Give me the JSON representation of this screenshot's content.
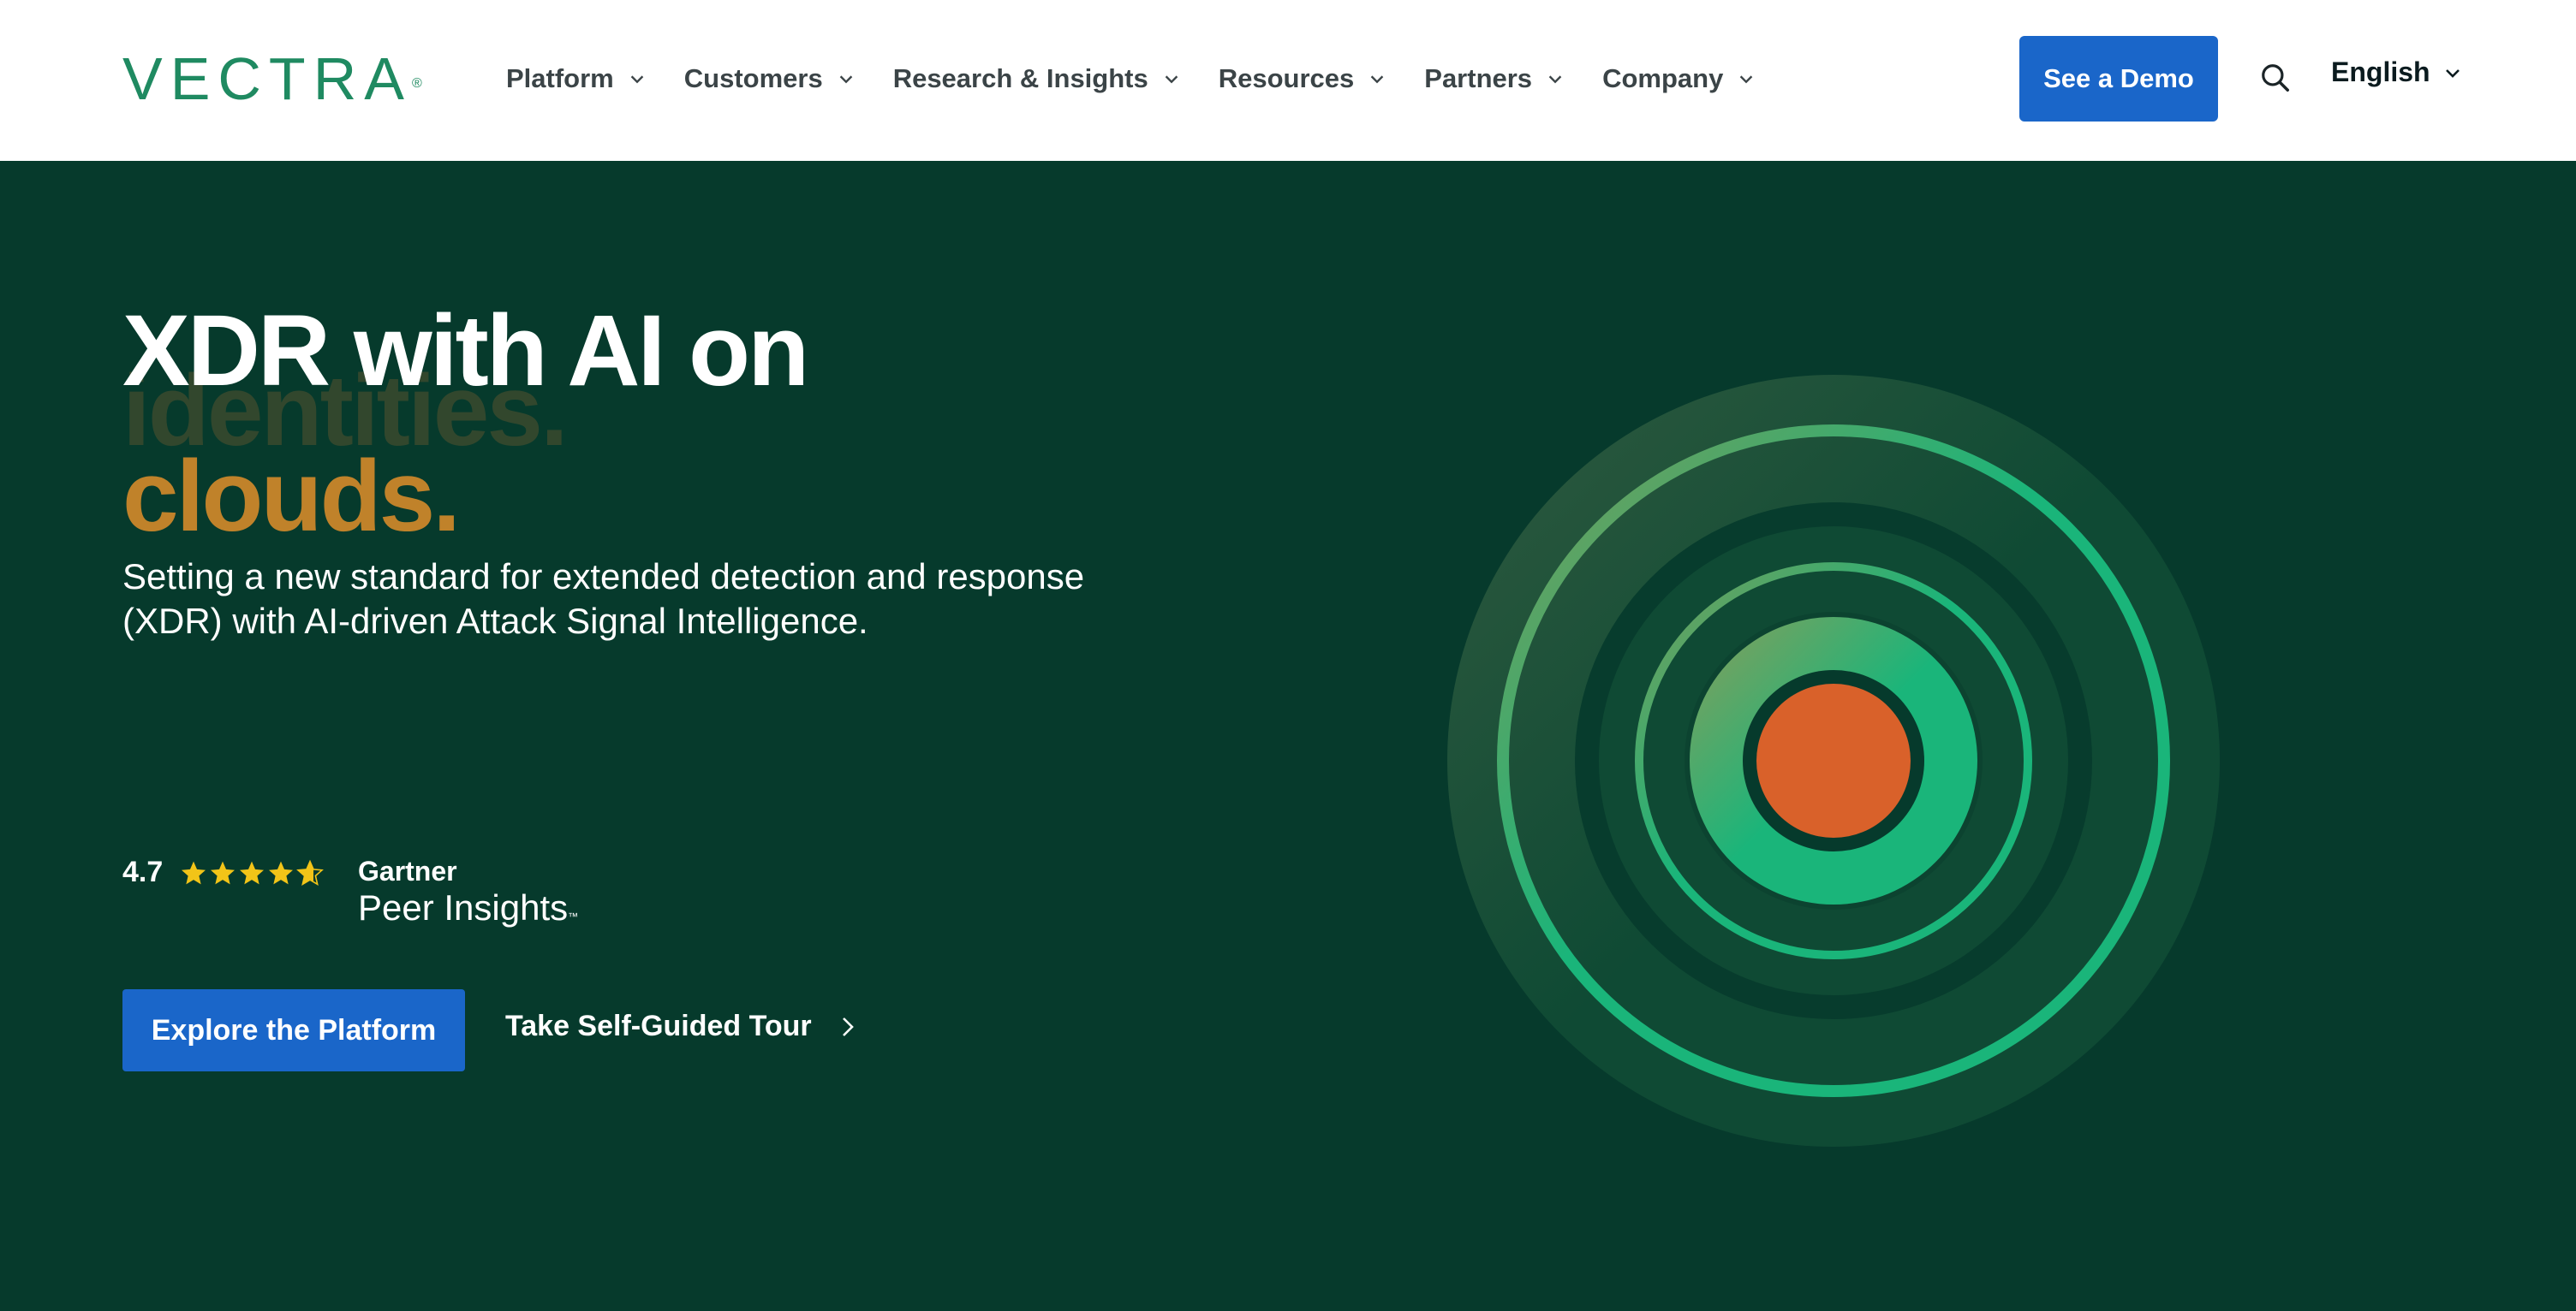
{
  "header": {
    "logo_text": "VECTRA",
    "logo_mark": "®",
    "nav": [
      {
        "label": "Platform"
      },
      {
        "label": "Customers"
      },
      {
        "label": "Research & Insights"
      },
      {
        "label": "Resources"
      },
      {
        "label": "Partners"
      },
      {
        "label": "Company"
      }
    ],
    "demo_label": "See a Demo",
    "search_icon": "search-icon",
    "language": "English"
  },
  "hero": {
    "headline_line1": "XDR with AI on",
    "headline_ghost": "identities.",
    "headline_line2": "clouds.",
    "subtitle": "Setting a new standard for extended detection and response (XDR) with AI-driven Attack Signal Intelligence.",
    "rating_value": "4.7",
    "star_rating": 4.7,
    "gartner_brand": "Gartner",
    "gartner_product": "Peer Insights",
    "gartner_tm": "™",
    "cta_primary": "Explore the Platform",
    "cta_secondary": "Take Self-Guided Tour"
  },
  "colors": {
    "brand_green": "#1f8a61",
    "hero_bg": "#063a2c",
    "accent_blue": "#1a66c9",
    "headline_gold": "#c0822a",
    "ring_green": "#1ab57a",
    "core_orange": "#d9612a"
  }
}
